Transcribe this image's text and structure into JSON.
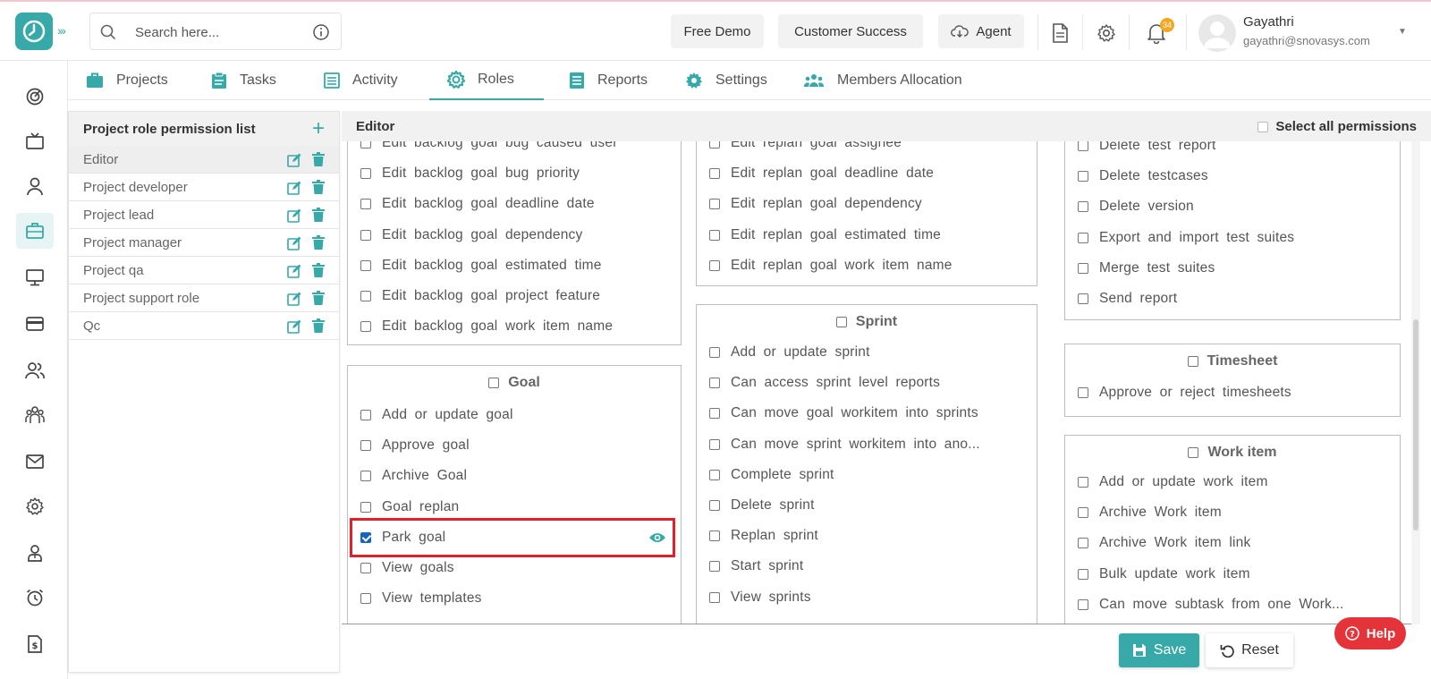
{
  "header": {
    "search_placeholder": "Search here...",
    "free_demo": "Free Demo",
    "customer_success": "Customer Success",
    "agent": "Agent",
    "notification_count": "34",
    "user_name": "Gayathri",
    "user_email": "gayathri@snovasys.com"
  },
  "nav": {
    "tabs": [
      {
        "label": "Projects"
      },
      {
        "label": "Tasks"
      },
      {
        "label": "Activity"
      },
      {
        "label": "Roles"
      },
      {
        "label": "Reports"
      },
      {
        "label": "Settings"
      },
      {
        "label": "Members Allocation"
      }
    ],
    "active": "Roles"
  },
  "roles": {
    "title": "Project role permission list",
    "items": [
      {
        "name": "Editor"
      },
      {
        "name": "Project developer"
      },
      {
        "name": "Project lead"
      },
      {
        "name": "Project manager"
      },
      {
        "name": "Project qa"
      },
      {
        "name": "Project support role"
      },
      {
        "name": "Qc"
      }
    ]
  },
  "permissions": {
    "role_title": "Editor",
    "select_all": "Select all permissions",
    "col1_top": [
      "Edit backlog goal bug caused user",
      "Edit backlog goal bug priority",
      "Edit backlog goal deadline date",
      "Edit backlog goal dependency",
      "Edit backlog goal estimated time",
      "Edit backlog goal project feature",
      "Edit backlog goal work item name"
    ],
    "goal": {
      "title": "Goal",
      "items": [
        "Add or update goal",
        "Approve goal",
        "Archive Goal",
        "Goal replan",
        "Park goal",
        "View goals",
        "View templates"
      ],
      "checked_item": "Park goal"
    },
    "col2_top": [
      "Edit replan goal assignee",
      "Edit replan goal deadline date",
      "Edit replan goal dependency",
      "Edit replan goal estimated time",
      "Edit replan goal work item name"
    ],
    "sprint": {
      "title": "Sprint",
      "items": [
        "Add or update sprint",
        "Can access sprint level reports",
        "Can move goal workitem into sprints",
        "Can move sprint workitem into ano...",
        "Complete sprint",
        "Delete sprint",
        "Replan sprint",
        "Start sprint",
        "View sprints"
      ]
    },
    "col3_top": [
      "Delete test report",
      "Delete testcases",
      "Delete version",
      "Export and import test suites",
      "Merge test suites",
      "Send report"
    ],
    "timesheet": {
      "title": "Timesheet",
      "items": [
        "Approve or reject timesheets"
      ]
    },
    "workitem": {
      "title": "Work item",
      "items": [
        "Add or update work item",
        "Archive Work item",
        "Archive Work item link",
        "Bulk update work item",
        "Can move subtask from one Work..."
      ]
    }
  },
  "actions": {
    "save": "Save",
    "reset": "Reset",
    "help": "Help"
  },
  "colors": {
    "accent": "#36a9a8",
    "highlight": "#e0202a",
    "help": "#e5333a",
    "checked": "#1565c0"
  }
}
